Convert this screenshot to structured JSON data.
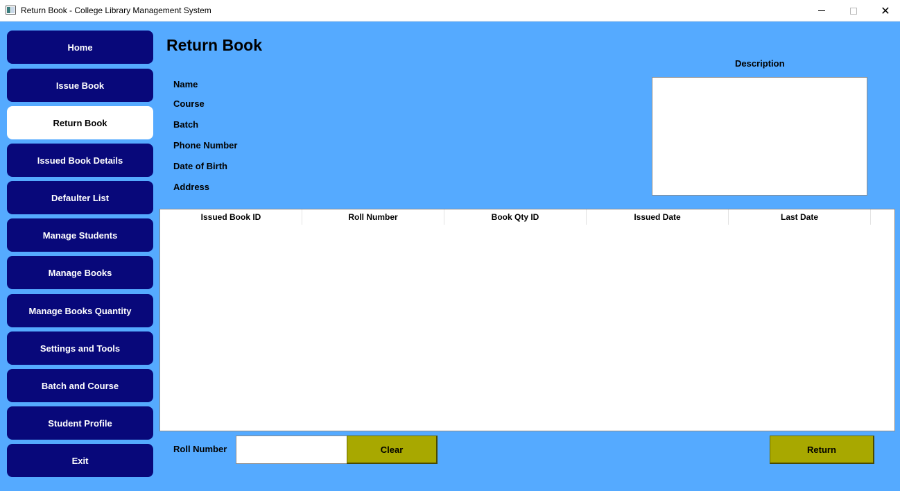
{
  "window": {
    "title": "Return Book - College Library Management System",
    "minimize_glyph": "—",
    "maximize_glyph": "☐",
    "close_glyph": "✕",
    "icon": "app-window-icon"
  },
  "sidebar": {
    "items": [
      {
        "label": "Home",
        "active": false
      },
      {
        "label": "Issue Book",
        "active": false
      },
      {
        "label": "Return Book",
        "active": true
      },
      {
        "label": "Issued Book Details",
        "active": false
      },
      {
        "label": "Defaulter List",
        "active": false
      },
      {
        "label": "Manage Students",
        "active": false
      },
      {
        "label": "Manage Books",
        "active": false
      },
      {
        "label": "Manage Books Quantity",
        "active": false
      },
      {
        "label": "Settings and Tools",
        "active": false
      },
      {
        "label": "Batch and Course",
        "active": false
      },
      {
        "label": "Student Profile",
        "active": false
      },
      {
        "label": "Exit",
        "active": false
      }
    ]
  },
  "main": {
    "title": "Return Book",
    "fields": {
      "name": "Name",
      "course": "Course",
      "batch": "Batch",
      "phone": "Phone Number",
      "dob": "Date of Birth",
      "address": "Address"
    },
    "description_label": "Description",
    "description_value": "",
    "table": {
      "columns": [
        "Issued Book ID",
        "Roll Number",
        "Book Qty ID",
        "Issued Date",
        "Last Date"
      ],
      "rows": []
    },
    "roll_number": {
      "label": "Roll Number",
      "value": "",
      "placeholder": ""
    },
    "clear_label": "Clear",
    "return_label": "Return"
  },
  "colors": {
    "background": "#55aaff",
    "nav_button": "#08087a",
    "nav_active": "#ffffff",
    "action_button": "#a8a800"
  }
}
